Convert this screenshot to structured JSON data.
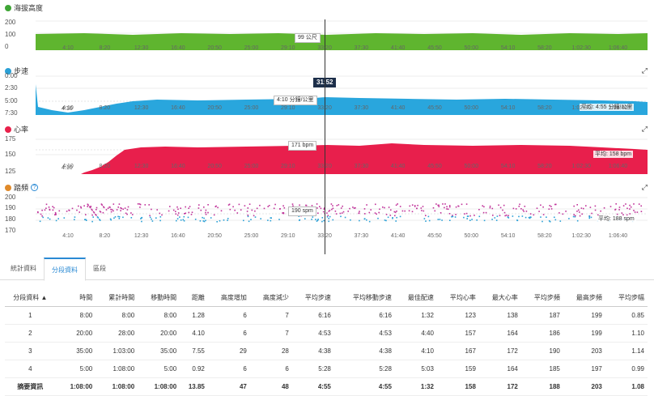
{
  "panels": {
    "altitude": {
      "title": "海拔高度",
      "color": "#3ea535",
      "ylabels": [
        "200",
        "100",
        "0"
      ],
      "tag": "99 公尺"
    },
    "pace": {
      "title": "步速",
      "color": "#2aa0d6",
      "ylabels": [
        "0:00",
        "2:30",
        "5:00",
        "7:30"
      ],
      "tag": "4:10 分鐘/公里",
      "avg": "平均: 4:55 分鐘/公里",
      "start": "4:10"
    },
    "hr": {
      "title": "心率",
      "color": "#e8214b",
      "ylabels": [
        "175",
        "150",
        "125"
      ],
      "tag": "171 bpm",
      "avg": "平均: 158 bpm",
      "start": "4:10"
    },
    "cadence": {
      "title": "踏頻",
      "color": "#e08a2a",
      "help": "?",
      "ylabels": [
        "200",
        "190",
        "180",
        "170"
      ],
      "tag": "190 spm",
      "avg": "平均: 188 spm"
    }
  },
  "xticks": [
    "4:10",
    "8:20",
    "12:30",
    "16:40",
    "20:50",
    "25:00",
    "29:10",
    "33:20",
    "37:30",
    "41:40",
    "45:50",
    "50:00",
    "54:10",
    "58:20",
    "1:02:30",
    "1:06:40"
  ],
  "cursor_time": "31:52",
  "expand_icon": "⤢",
  "tabs": [
    "統計資料",
    "分段資料",
    "區段"
  ],
  "table": {
    "headers": [
      "分段資料 ▲",
      "時間",
      "累計時間",
      "移動時間",
      "距離",
      "高度增加",
      "高度減少",
      "平均步速",
      "平均移動步速",
      "最佳配速",
      "平均心率",
      "最大心率",
      "平均步頻",
      "最高步頻",
      "平均步幅"
    ],
    "rows": [
      [
        "1",
        "8:00",
        "8:00",
        "8:00",
        "1.28",
        "6",
        "7",
        "6:16",
        "6:16",
        "1:32",
        "123",
        "138",
        "187",
        "199",
        "0.85"
      ],
      [
        "2",
        "20:00",
        "28:00",
        "20:00",
        "4.10",
        "6",
        "7",
        "4:53",
        "4:53",
        "4:40",
        "157",
        "164",
        "186",
        "199",
        "1.10"
      ],
      [
        "3",
        "35:00",
        "1:03:00",
        "35:00",
        "7.55",
        "29",
        "28",
        "4:38",
        "4:38",
        "4:10",
        "167",
        "172",
        "190",
        "203",
        "1.14"
      ],
      [
        "4",
        "5:00",
        "1:08:00",
        "5:00",
        "0.92",
        "6",
        "6",
        "5:28",
        "5:28",
        "5:03",
        "159",
        "164",
        "185",
        "197",
        "0.99"
      ]
    ],
    "summary": [
      "摘要資訊",
      "1:08:00",
      "1:08:00",
      "1:08:00",
      "13.85",
      "47",
      "48",
      "4:55",
      "4:55",
      "1:32",
      "158",
      "172",
      "188",
      "203",
      "1.08"
    ]
  }
}
